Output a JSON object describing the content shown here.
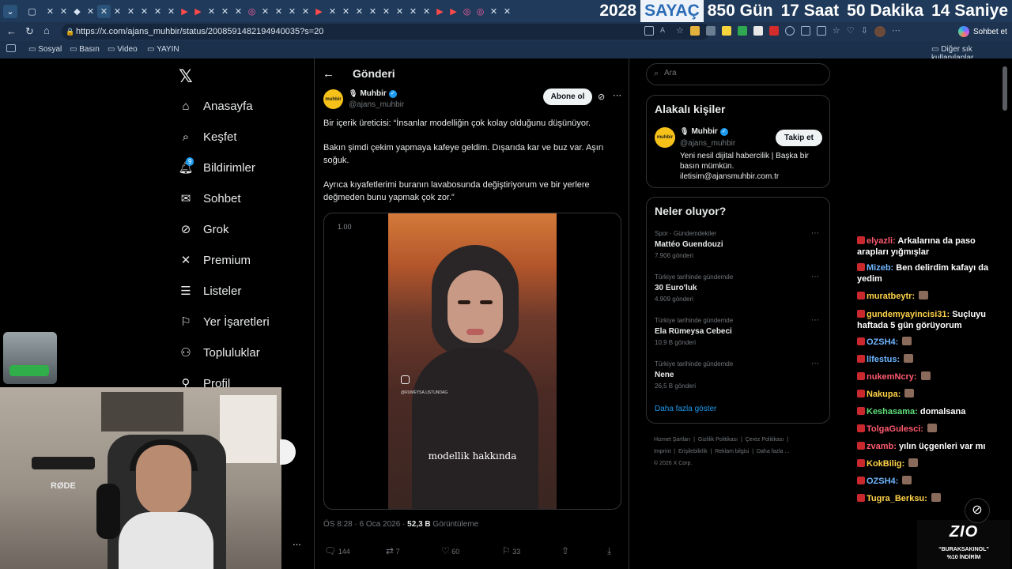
{
  "browser": {
    "tab_count_icons": 40,
    "countdown": {
      "year": "2028",
      "label": "SAYAÇ",
      "days": "850 Gün",
      "hours": "17 Saat",
      "minutes": "50 Dakika",
      "seconds": "14 Saniye"
    },
    "url": "https://x.com/ajans_muhbir/status/2008591482194940035?s=20",
    "copilot_label": "Sohbet et",
    "bookmarks": [
      "Sosyal",
      "Basın",
      "Video",
      "YAYIN"
    ],
    "other_bookmarks": "Diğer sık kullanılanlar"
  },
  "nav": {
    "items": [
      "Anasayfa",
      "Keşfet",
      "Bildirimler",
      "Sohbet",
      "Grok",
      "Premium",
      "Listeler",
      "Yer İşaretleri",
      "Topluluklar",
      "Profil"
    ],
    "notif_count": "9",
    "more": "..."
  },
  "post": {
    "header": "Gönderi",
    "author_name": "Muhbir",
    "author_handle": "@ajans_muhbir",
    "avatar_text": "muhbir",
    "subscribe": "Abone ol",
    "paragraphs": [
      "Bir içerik üreticisi: “İnsanlar modelliğin çok kolay olduğunu düşünüyor.",
      "Bakın şimdi çekim yapmaya kafeye geldim. Dışarıda kar ve buz var. Aşırı soğuk.",
      "Ayrıca kıyafetlerimi buranın lavabosunda değiştiriyorum ve bir yerlere değmeden bunu yapmak çok zor.”"
    ],
    "video": {
      "speed": "1.00",
      "ig_handle": "@RUMEYSA.USTUNDAG",
      "caption": "modellik hakkında"
    },
    "meta_time": "ÖS 8:28 · 6 Oca 2026 · ",
    "views": "52,3 B",
    "views_label": " Görüntüleme",
    "actions": {
      "replies": "144",
      "reposts": "7",
      "likes": "60",
      "bookmarks": "33"
    }
  },
  "right": {
    "search_placeholder": "Ara",
    "related_title": "Alakalı kişiler",
    "related": {
      "name": "Muhbir",
      "handle": "@ajans_muhbir",
      "bio": "Yeni nesil dijital habercilik | Başka bir basın mümkün. iletisim@ajansmuhbir.com.tr",
      "follow": "Takip et"
    },
    "trends_title": "Neler oluyor?",
    "trends": [
      {
        "context": "Spor · Gündemdekiler",
        "name": "Mattéo Guendouzi",
        "count": "7.906 gönderi"
      },
      {
        "context": "Türkiye tarihinde gündemde",
        "name": "30 Euro'luk",
        "count": "4.909 gönderi"
      },
      {
        "context": "Türkiye tarihinde gündemde",
        "name": "Ela Rümeysa Cebeci",
        "count": "10,9 B gönderi"
      },
      {
        "context": "Türkiye tarihinde gündemde",
        "name": "Nene",
        "count": "26,5 B gönderi"
      }
    ],
    "show_more": "Daha fazla göster",
    "footer": [
      "Hizmet Şartları",
      "Gizlilik Politikası",
      "Çerez Politikası",
      "Imprint",
      "Erişilebilirlik",
      "Reklam bilgisi",
      "Daha fazla ...",
      "© 2026 X Corp."
    ]
  },
  "chat": [
    {
      "user": "elyazli:",
      "text": "Arkalarına da paso arapları yığmışlar",
      "color": "#ff5a6e"
    },
    {
      "user": "Mizeb:",
      "text": "Ben delirdim kafayı da yedim",
      "color": "#6fb6ff"
    },
    {
      "user": "muratbeytr:",
      "text": "",
      "color": "#ffd34a"
    },
    {
      "user": "gundemyayincisi31:",
      "text": "Suçluyu haftada 5 gün görüyorum",
      "color": "#ffd34a"
    },
    {
      "user": "OZSH4:",
      "text": "",
      "color": "#6fb6ff"
    },
    {
      "user": "llfestus:",
      "text": "",
      "color": "#6fb6ff"
    },
    {
      "user": "nukemNcry:",
      "text": "",
      "color": "#ff5a6e"
    },
    {
      "user": "Nakupa:",
      "text": "",
      "color": "#ffd34a"
    },
    {
      "user": "Keshasama:",
      "text": "domalsana",
      "color": "#5fe07a"
    },
    {
      "user": "TolgaGulesci:",
      "text": "",
      "color": "#ff5a6e"
    },
    {
      "user": "zvamb:",
      "text": "yılın üçgenleri var mı",
      "color": "#ff5a6e"
    },
    {
      "user": "KokBilig:",
      "text": "",
      "color": "#ffd34a"
    },
    {
      "user": "OZSH4:",
      "text": "",
      "color": "#6fb6ff"
    },
    {
      "user": "Tugra_Berksu:",
      "text": "",
      "color": "#ffd34a"
    }
  ],
  "overlay": {
    "brand": "ZIO",
    "promo1": "“BURAKSAKINOL”",
    "promo2": "%10 İNDİRİM",
    "mic_label": "RØDE"
  }
}
